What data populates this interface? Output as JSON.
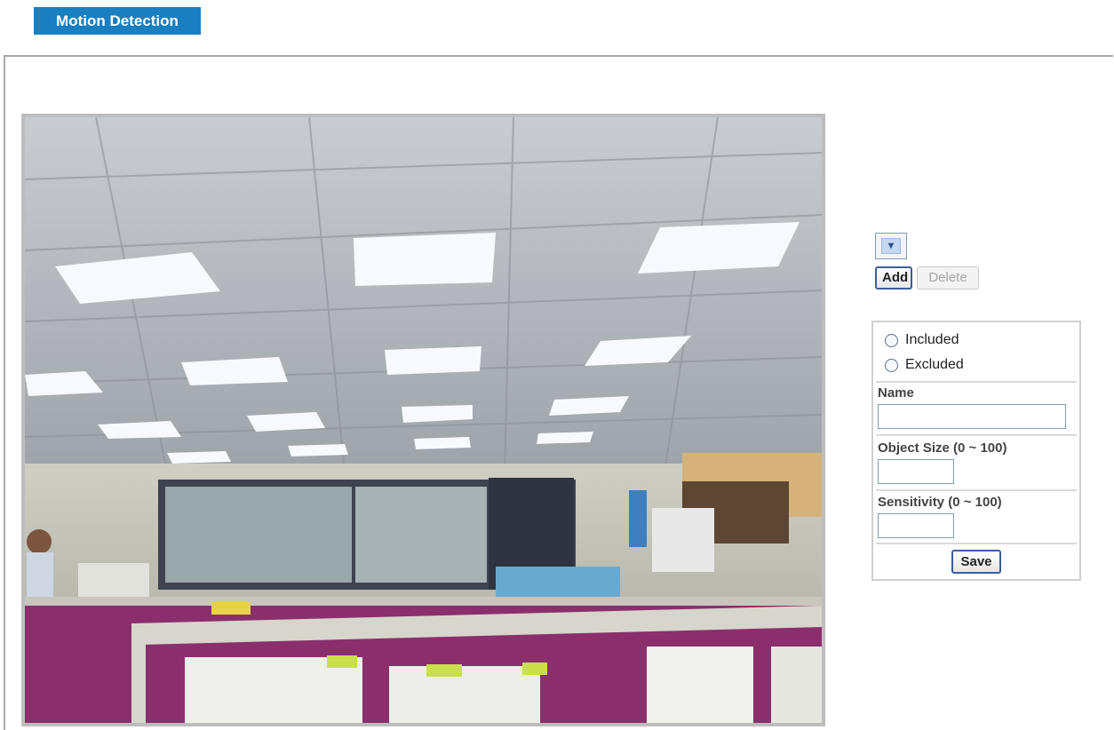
{
  "header": {
    "title": "Motion Detection"
  },
  "camera": {
    "feed_icon": "camera-feed"
  },
  "controls": {
    "region_select_value": "",
    "add_label": "Add",
    "delete_label": "Delete"
  },
  "form": {
    "included_label": "Included",
    "excluded_label": "Excluded",
    "name_label": "Name",
    "name_value": "",
    "object_size_label": "Object Size  (0 ~ 100)",
    "object_size_value": "",
    "sensitivity_label": "Sensitivity  (0 ~ 100)",
    "sensitivity_value": "",
    "save_label": "Save"
  }
}
